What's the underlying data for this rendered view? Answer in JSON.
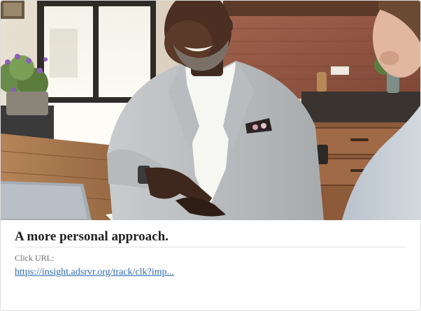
{
  "ad": {
    "image_alt": "Smiling man in a light gray suit seated at a wooden table in a kitchen, pointing at paperwork while talking with another person",
    "headline": "A more personal approach.",
    "click_label": "Click URL:",
    "click_url": "https://insight.adsrvr.org/track/clk?imp...",
    "link_color": "#2a6ab3"
  }
}
